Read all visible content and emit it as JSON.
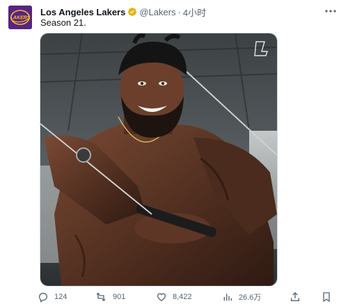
{
  "author": {
    "display_name": "Los Angeles Lakers",
    "handle": "@Lakers",
    "separator": "·",
    "time": "4小时",
    "avatar_text": "LAKERS"
  },
  "tweet": {
    "text": "Season 21."
  },
  "media": {
    "watermark": "L"
  },
  "actions": {
    "reply_count": "124",
    "retweet_count": "901",
    "like_count": "8,422",
    "views_count": "26.6万"
  },
  "colors": {
    "avatar_bg": "#552583",
    "avatar_gold": "#fdb927",
    "verified_gold": "#e2b719",
    "muted_text": "#536471"
  },
  "icons": {
    "verified": "verified-badge-icon",
    "more": "more-icon",
    "reply": "reply-icon",
    "retweet": "retweet-icon",
    "like": "heart-icon",
    "views": "views-icon",
    "share": "share-icon",
    "bookmark": "bookmark-icon"
  }
}
